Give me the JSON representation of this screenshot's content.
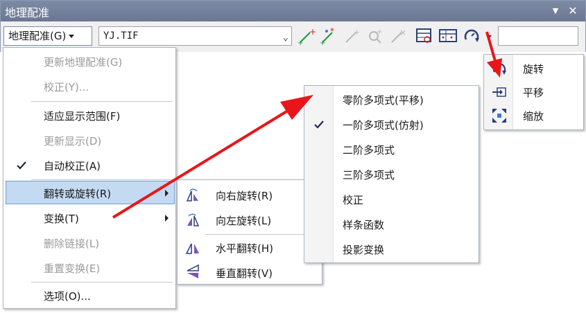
{
  "window": {
    "title": "地理配准",
    "menu_button_label": "地理配准(G)",
    "layer_value": "YJ.TIF",
    "tool_icons": [
      "add-control-points-icon",
      "auto-add-points-icon",
      "select-link-icon",
      "zoom-to-link-icon",
      "delete-link-icon",
      "view-link-table-icon",
      "view-link-table-alt-icon",
      "rotate-tool-icon"
    ]
  },
  "main_menu": {
    "items": [
      {
        "label": "更新地理配准(G)",
        "enabled": false
      },
      {
        "label": "校正(Y)...",
        "enabled": false
      },
      {
        "label": "适应显示范围(F)",
        "enabled": true
      },
      {
        "label": "更新显示(D)",
        "enabled": false
      },
      {
        "label": "自动校正(A)",
        "enabled": true,
        "checked": true
      },
      {
        "label": "翻转或旋转(R)",
        "enabled": true,
        "highlighted": true,
        "submenu": true
      },
      {
        "label": "变换(T)",
        "enabled": true,
        "submenu": true
      },
      {
        "label": "删除链接(L)",
        "enabled": false
      },
      {
        "label": "重置变换(E)",
        "enabled": false
      },
      {
        "label": "选项(O)...",
        "enabled": true
      }
    ]
  },
  "flip_menu": {
    "items": [
      {
        "label": "向右旋转(R)",
        "icon": "rotate-right-icon"
      },
      {
        "label": "向左旋转(L)",
        "icon": "rotate-left-icon"
      },
      {
        "label": "水平翻转(H)",
        "icon": "flip-horizontal-icon"
      },
      {
        "label": "垂直翻转(V)",
        "icon": "flip-vertical-icon"
      }
    ]
  },
  "transform_menu": {
    "items": [
      {
        "label": "零阶多项式(平移)"
      },
      {
        "label": "一阶多项式(仿射)",
        "checked": true
      },
      {
        "label": "二阶多项式"
      },
      {
        "label": "三阶多项式"
      },
      {
        "label": "校正"
      },
      {
        "label": "样条函数"
      },
      {
        "label": "投影变换"
      }
    ]
  },
  "tool_menu": {
    "items": [
      {
        "label": "旋转",
        "icon": "rotate-icon"
      },
      {
        "label": "平移",
        "icon": "shift-icon"
      },
      {
        "label": "缩放",
        "icon": "scale-icon"
      }
    ]
  },
  "colors": {
    "titlebar": "#7b88a2",
    "highlight": "#c4daf2",
    "annotation_arrow": "#e8161b",
    "disabled_text": "#9a9a9a"
  }
}
